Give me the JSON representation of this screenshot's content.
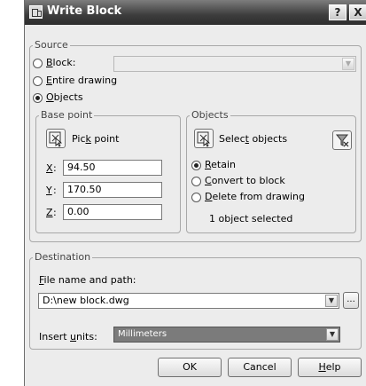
{
  "window": {
    "title": "Write Block",
    "help_button": "?",
    "close_button": "X"
  },
  "source": {
    "label": "Source",
    "options": [
      {
        "label": "Block:",
        "mnemonic": "B",
        "rest": "lock:",
        "checked": false
      },
      {
        "label": "Entire drawing",
        "mnemonic": "E",
        "rest": "ntire drawing",
        "checked": false
      },
      {
        "label": "Objects",
        "mnemonic": "O",
        "rest": "bjects",
        "checked": true
      }
    ],
    "block_dropdown_value": ""
  },
  "base_point": {
    "label": "Base point",
    "pick_button": {
      "before": "Pic",
      "mnemonic": "k",
      "after": " point"
    },
    "x": {
      "label": "X",
      "value": "94.50"
    },
    "y": {
      "label": "Y",
      "value": "170.50"
    },
    "z": {
      "label": "Z",
      "value": "0.00"
    }
  },
  "objects": {
    "label": "Objects",
    "select_button": {
      "before": "Selec",
      "mnemonic": "t",
      "after": " objects"
    },
    "options": [
      {
        "mnemonic": "R",
        "rest": "etain",
        "checked": true
      },
      {
        "mnemonic": "C",
        "rest": "onvert to block",
        "checked": false
      },
      {
        "mnemonic": "D",
        "rest": "elete from drawing",
        "checked": false
      }
    ],
    "status": "1 object selected"
  },
  "destination": {
    "label": "Destination",
    "file_label": {
      "mnemonic": "F",
      "rest": "ile name and path:"
    },
    "file_value": "D:\\new block.dwg",
    "browse_label": "...",
    "units_label": {
      "before": "Insert ",
      "mnemonic": "u",
      "after": "nits:"
    },
    "units_value": "Millimeters"
  },
  "buttons": {
    "ok": "OK",
    "cancel": "Cancel",
    "help": {
      "mnemonic": "H",
      "rest": "elp"
    }
  },
  "icons": {
    "app": "write-block-icon",
    "pick": "pick-point-icon",
    "select": "select-objects-icon",
    "filter": "quick-select-filter-icon"
  }
}
